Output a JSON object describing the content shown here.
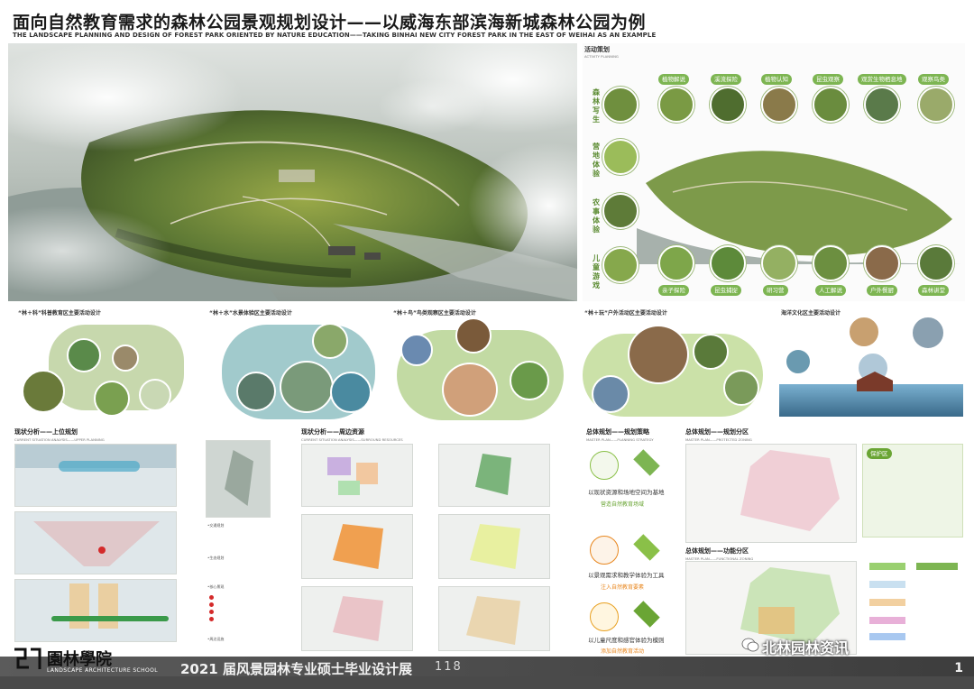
{
  "header": {
    "title_cn": "面向自然教育需求的森林公园景观规划设计——以威海东部滨海新城森林公园为例",
    "title_en": "THE LANDSCAPE PLANNING AND DESIGN OF FOREST PARK ORIENTED BY NATURE EDUCATION——TAKING BINHAI NEW CITY FOREST PARK IN THE EAST OF WEIHAI AS AN EXAMPLE"
  },
  "activity": {
    "title": "活动策划",
    "subtitle": "ACTIVITY PLANNING",
    "left_labels": [
      "森林写生",
      "营地体验",
      "农事体验",
      "儿童游戏"
    ],
    "top_tags": [
      "植物解说",
      "溪流探险",
      "植物认知",
      "昆虫观察",
      "观赏生物栖息地",
      "观察鸟类"
    ],
    "bottom_tags": [
      "亲子探险",
      "昆虫捕捉",
      "研习营",
      "人工解说",
      "户外餐厨",
      "森林讲堂"
    ]
  },
  "panels": {
    "p1": "“林＋科”科普教育区主要活动设计",
    "p2": "“林＋水”水景体验区主要活动设计",
    "p3": "“林＋鸟”鸟类观察区主要活动设计",
    "p4": "“林＋玩”户外活动区主要活动设计",
    "p5": "海洋文化区主要活动设计"
  },
  "analysis": {
    "upper_title": "现状分析——上位规划",
    "upper_sub": "CURRENT SITUATION ANALYSIS——UPPER PLANNING",
    "surround_title": "现状分析——周边资源",
    "surround_sub": "CURRENT SITUATION ANALYSIS——SURROUND RESOURCES",
    "notes": [
      "•交通规划",
      "•生态规划",
      "•核心景观",
      "•周边设施"
    ]
  },
  "strategy": {
    "title": "总体规划——规划策略",
    "sub": "MASTER PLAN——PLANNING STRATEGY",
    "items": [
      {
        "text": "以现状资源和场地空间为基地",
        "accent": "营造自然教育场域"
      },
      {
        "text": "以景观需求和教学体验为工具",
        "accent": "注入自然教育要素"
      },
      {
        "text": "以儿童尺度和感官体验为模则",
        "accent": "添加自然教育活动"
      }
    ]
  },
  "zoning": {
    "protect_title": "总体规划——规划分区",
    "protect_sub": "MASTER PLAN——PROTECTED ZONING",
    "protect_tag": "保护区",
    "func_title": "总体规划——功能分区",
    "func_sub": "MASTER PLAN——FUNCTIONAL ZONING"
  },
  "footer": {
    "logo_cn": "園林學院",
    "logo_en": "LANDSCAPE ARCHITECTURE SCHOOL",
    "exhibit": "2021 届风景园林专业硕士毕业设计展",
    "number": "118",
    "page": "1",
    "watermark": "北林园林资讯"
  },
  "colors": {
    "accent_green": "#7db552",
    "accent_orange": "#e8871f",
    "footer_bg": "#4a4a4a",
    "zone_pink": "#e88aa0"
  }
}
